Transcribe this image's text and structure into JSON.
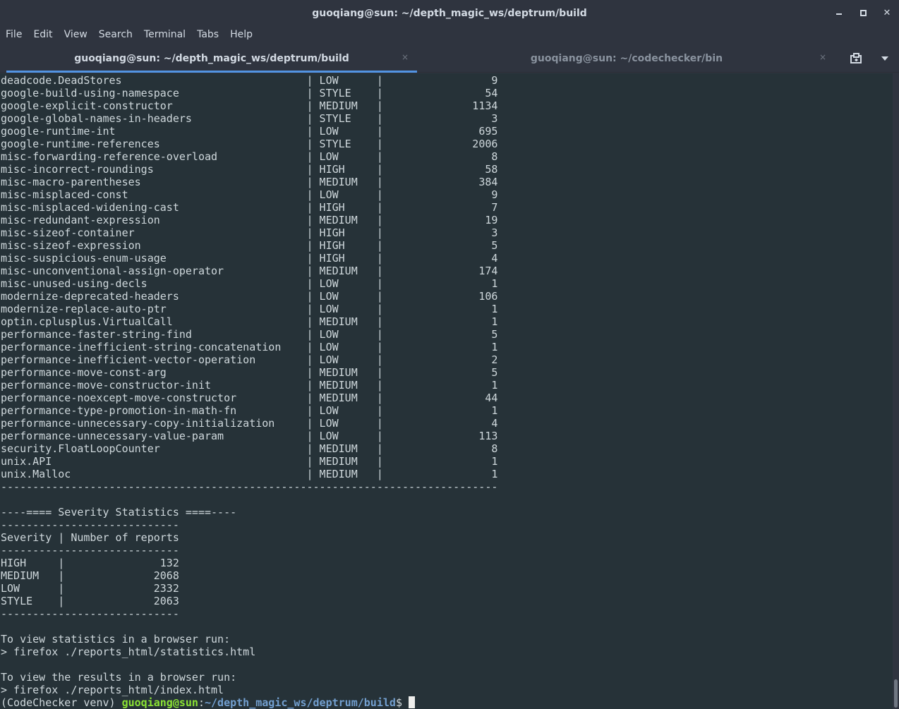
{
  "window": {
    "title": "guoqiang@sun: ~/depth_magic_ws/deptrum/build",
    "minimize_label": "minimize",
    "maximize_label": "maximize",
    "close_label": "✕"
  },
  "menu": [
    "File",
    "Edit",
    "View",
    "Search",
    "Terminal",
    "Tabs",
    "Help"
  ],
  "tabs": [
    {
      "title": "guoqiang@sun: ~/depth_magic_ws/deptrum/build",
      "close": "×"
    },
    {
      "title": "guoqiang@sun: ~/codechecker/bin",
      "close": "×"
    }
  ],
  "toolbar": {
    "new_tab_icon": "new-tab-icon",
    "dropdown_icon": "chevron-down-icon"
  },
  "colors": {
    "accent": "#5294e2",
    "terminal_bg": "#263238",
    "prompt_user": "#8ae234",
    "prompt_path": "#729fcf"
  },
  "terminal": {
    "checker_rows": [
      {
        "checker": "deadcode.DeadStores",
        "severity": "LOW",
        "count": "9"
      },
      {
        "checker": "google-build-using-namespace",
        "severity": "STYLE",
        "count": "54"
      },
      {
        "checker": "google-explicit-constructor",
        "severity": "MEDIUM",
        "count": "1134"
      },
      {
        "checker": "google-global-names-in-headers",
        "severity": "STYLE",
        "count": "3"
      },
      {
        "checker": "google-runtime-int",
        "severity": "LOW",
        "count": "695"
      },
      {
        "checker": "google-runtime-references",
        "severity": "STYLE",
        "count": "2006"
      },
      {
        "checker": "misc-forwarding-reference-overload",
        "severity": "LOW",
        "count": "8"
      },
      {
        "checker": "misc-incorrect-roundings",
        "severity": "HIGH",
        "count": "58"
      },
      {
        "checker": "misc-macro-parentheses",
        "severity": "MEDIUM",
        "count": "384"
      },
      {
        "checker": "misc-misplaced-const",
        "severity": "LOW",
        "count": "9"
      },
      {
        "checker": "misc-misplaced-widening-cast",
        "severity": "HIGH",
        "count": "7"
      },
      {
        "checker": "misc-redundant-expression",
        "severity": "MEDIUM",
        "count": "19"
      },
      {
        "checker": "misc-sizeof-container",
        "severity": "HIGH",
        "count": "3"
      },
      {
        "checker": "misc-sizeof-expression",
        "severity": "HIGH",
        "count": "5"
      },
      {
        "checker": "misc-suspicious-enum-usage",
        "severity": "HIGH",
        "count": "4"
      },
      {
        "checker": "misc-unconventional-assign-operator",
        "severity": "MEDIUM",
        "count": "174"
      },
      {
        "checker": "misc-unused-using-decls",
        "severity": "LOW",
        "count": "1"
      },
      {
        "checker": "modernize-deprecated-headers",
        "severity": "LOW",
        "count": "106"
      },
      {
        "checker": "modernize-replace-auto-ptr",
        "severity": "LOW",
        "count": "1"
      },
      {
        "checker": "optin.cplusplus.VirtualCall",
        "severity": "MEDIUM",
        "count": "1"
      },
      {
        "checker": "performance-faster-string-find",
        "severity": "LOW",
        "count": "5"
      },
      {
        "checker": "performance-inefficient-string-concatenation",
        "severity": "LOW",
        "count": "1"
      },
      {
        "checker": "performance-inefficient-vector-operation",
        "severity": "LOW",
        "count": "2"
      },
      {
        "checker": "performance-move-const-arg",
        "severity": "MEDIUM",
        "count": "5"
      },
      {
        "checker": "performance-move-constructor-init",
        "severity": "MEDIUM",
        "count": "1"
      },
      {
        "checker": "performance-noexcept-move-constructor",
        "severity": "MEDIUM",
        "count": "44"
      },
      {
        "checker": "performance-type-promotion-in-math-fn",
        "severity": "LOW",
        "count": "1"
      },
      {
        "checker": "performance-unnecessary-copy-initialization",
        "severity": "LOW",
        "count": "4"
      },
      {
        "checker": "performance-unnecessary-value-param",
        "severity": "LOW",
        "count": "113"
      },
      {
        "checker": "security.FloatLoopCounter",
        "severity": "MEDIUM",
        "count": "8"
      },
      {
        "checker": "unix.API",
        "severity": "MEDIUM",
        "count": "1"
      },
      {
        "checker": "unix.Malloc",
        "severity": "MEDIUM",
        "count": "1"
      }
    ],
    "checker_table_rule": "------------------------------------------------------------------------------",
    "severity_title": "----==== Severity Statistics ====----",
    "severity_rule": "----------------------------",
    "severity_header": "Severity | Number of reports",
    "severity_rows": [
      {
        "severity": "HIGH",
        "count": "132"
      },
      {
        "severity": "MEDIUM",
        "count": "2068"
      },
      {
        "severity": "LOW",
        "count": "2332"
      },
      {
        "severity": "STYLE",
        "count": "2063"
      }
    ],
    "stats_hint": "To view statistics in a browser run:",
    "stats_cmd": "> firefox ./reports_html/statistics.html",
    "results_hint": "To view the results in a browser run:",
    "results_cmd": "> firefox ./reports_html/index.html",
    "prompt": {
      "venv": "(CodeChecker venv) ",
      "user_host": "guoqiang@sun",
      "sep": ":",
      "path": "~/depth_magic_ws/deptrum/build",
      "dollar": "$ "
    }
  }
}
